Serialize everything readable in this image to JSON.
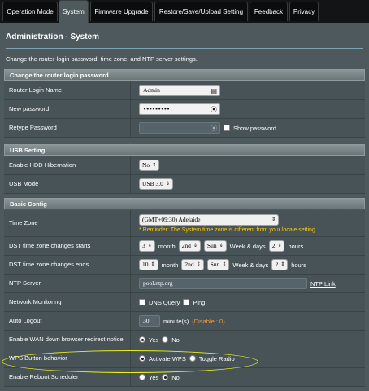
{
  "tabs": [
    {
      "label": "Operation Mode"
    },
    {
      "label": "System"
    },
    {
      "label": "Firmware Upgrade"
    },
    {
      "label": "Restore/Save/Upload Setting"
    },
    {
      "label": "Feedback"
    },
    {
      "label": "Privacy"
    }
  ],
  "page": {
    "title": "Administration - System",
    "description": "Change the router login password, time zone, and NTP server settings."
  },
  "login": {
    "header": "Change the router login password",
    "name_label": "Router Login Name",
    "name_value": "Admin",
    "new_pw_label": "New password",
    "new_pw_value": "•••••••••",
    "retype_label": "Retype Password",
    "show_password_label": "Show password"
  },
  "usb": {
    "header": "USB Setting",
    "hdd_label": "Enable HDD Hibernation",
    "hdd_value": "No",
    "mode_label": "USB Mode",
    "mode_value": "USB 3.0"
  },
  "basic": {
    "header": "Basic Config",
    "timezone_label": "Time Zone",
    "timezone_value": "(GMT+09:30) Adelaide",
    "timezone_reminder": "* Reminder: The System time zone is different from your locale setting.",
    "dst_start_label": "DST time zone changes starts",
    "dst_start": {
      "month": "3",
      "nth": "2nd",
      "day": "Sun",
      "hours": "2"
    },
    "dst_end_label": "DST time zone changes ends",
    "dst_end": {
      "month": "10",
      "nth": "2nd",
      "day": "Sun",
      "hours": "2"
    },
    "month_word": "month",
    "week_days_word": "Week & days",
    "hours_word": "hours",
    "ntp_label": "NTP Server",
    "ntp_value": "pool.ntp.org",
    "ntp_link": "NTP Link",
    "netmon_label": "Network Monitoring",
    "dns_query": "DNS Query",
    "ping": "Ping",
    "logout_label": "Auto Logout",
    "logout_value": "30",
    "logout_unit": "minute(s)",
    "logout_note": "(Disable : 0)",
    "wan_redirect_label": "Enable WAN down browser redirect notice",
    "wan_redirect_yes": "Yes",
    "wan_redirect_no": "No",
    "wps_label": "WPS Button behavior",
    "wps_activate": "Activate WPS",
    "wps_toggle": "Toggle Radio",
    "reboot_label": "Enable Reboot Scheduler",
    "reboot_yes": "Yes",
    "reboot_no": "No"
  },
  "colors": {
    "panel": "#4d595d",
    "warning": "#ffcc00",
    "annotation": "#e8f020"
  }
}
